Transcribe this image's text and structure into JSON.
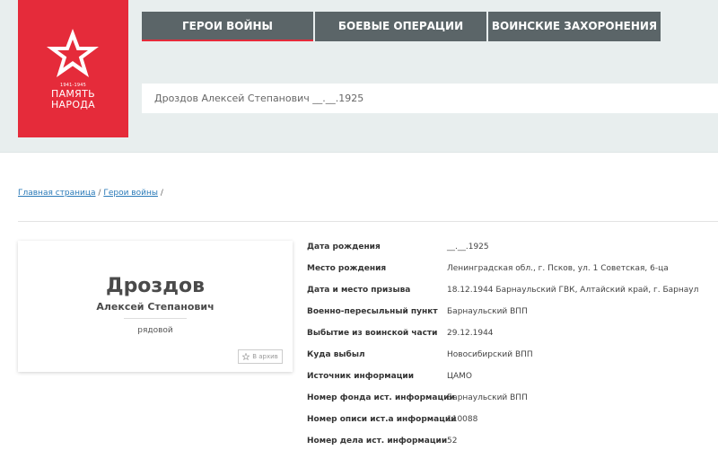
{
  "logo": {
    "years": "1941-1945",
    "line1": "ПАМЯТЬ",
    "line2": "НАРОДА",
    "color": "#e52b3a"
  },
  "nav": {
    "items": [
      {
        "label": "ГЕРОИ ВОЙНЫ",
        "active": true
      },
      {
        "label": "БОЕВЫЕ ОПЕРАЦИИ",
        "active": false
      },
      {
        "label": "ВОИНСКИЕ ЗАХОРОНЕНИЯ",
        "active": false
      }
    ]
  },
  "search": {
    "value": "Дроздов Алексей Степанович __.__.1925"
  },
  "breadcrumb": {
    "home": "Главная страница",
    "section": "Герои войны",
    "sep": "/"
  },
  "hero": {
    "surname": "Дроздов",
    "given_names": "Алексей Степанович",
    "rank": "рядовой",
    "archive_label": "В архив"
  },
  "info": [
    {
      "label": "Дата рождения",
      "value": "__.__.1925"
    },
    {
      "label": "Место рождения",
      "value": "Ленинградская обл., г. Псков, ул. 1 Советская, 6-ца"
    },
    {
      "label": "Дата и место призыва",
      "value": "18.12.1944 Барнаульский ГВК, Алтайский край, г. Барнаул"
    },
    {
      "label": "Военно-пересыльный пункт",
      "value": "Барнаульский ВПП"
    },
    {
      "label": "Выбытие из воинской части",
      "value": "29.12.1944"
    },
    {
      "label": "Куда выбыл",
      "value": "Новосибирский ВПП"
    },
    {
      "label": "Источник информации",
      "value": "ЦАМО"
    },
    {
      "label": "Номер фонда ист. информации",
      "value": "Барнаульский ВПП"
    },
    {
      "label": "Номер описи ист.а информации",
      "value": "110088"
    },
    {
      "label": "Номер дела ист. информации",
      "value": "52"
    }
  ]
}
